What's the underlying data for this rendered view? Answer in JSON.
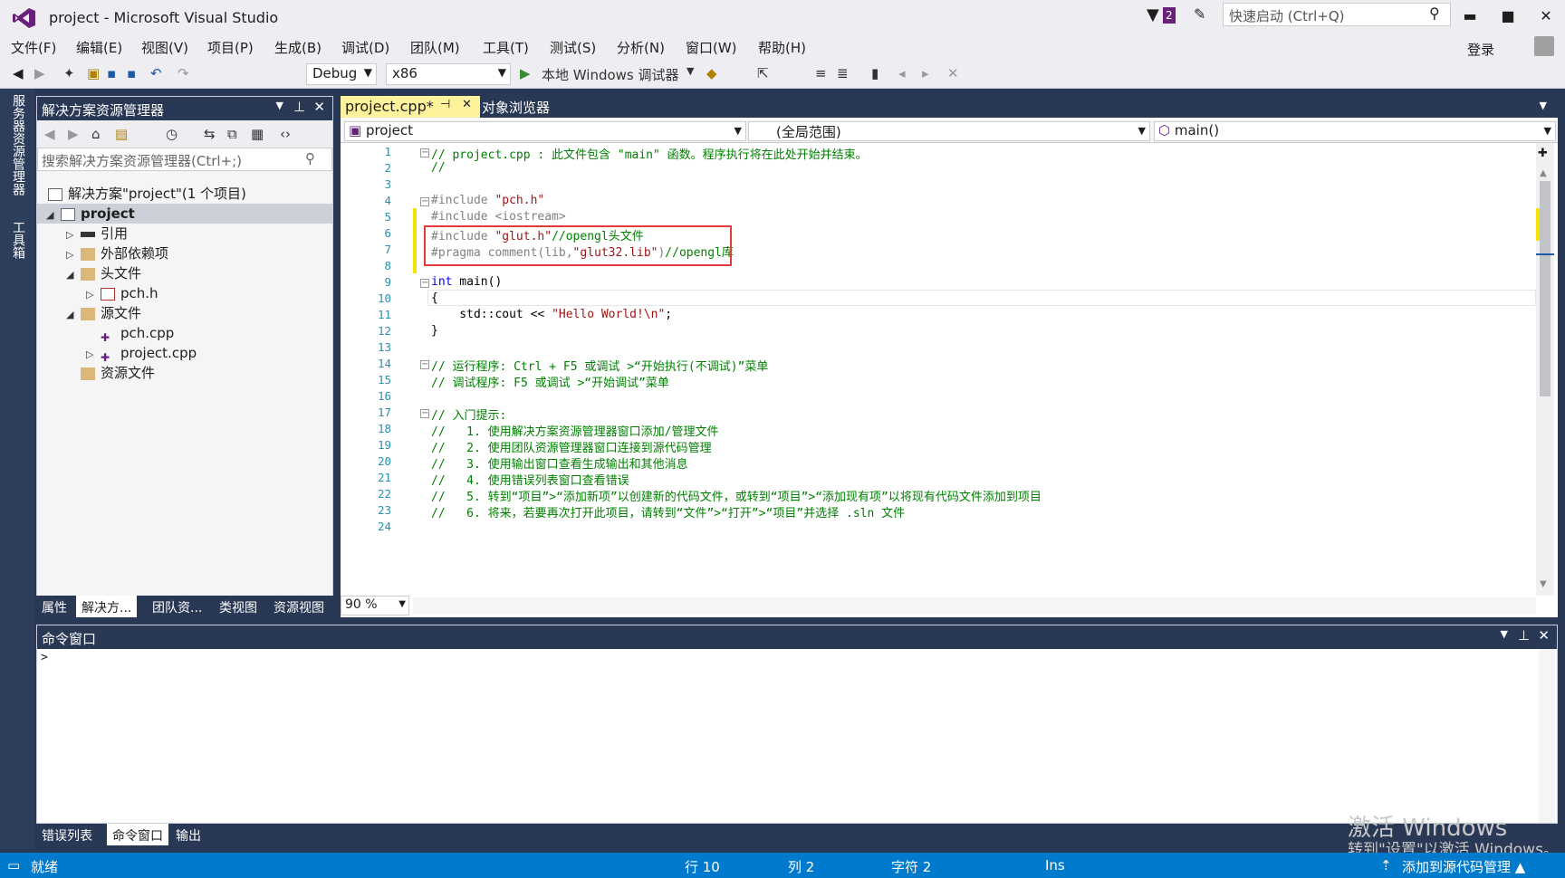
{
  "window": {
    "title": "project - Microsoft Visual Studio",
    "notification_count": "2",
    "quick_launch_placeholder": "快速启动 (Ctrl+Q)"
  },
  "menu": [
    "文件(F)",
    "编辑(E)",
    "视图(V)",
    "项目(P)",
    "生成(B)",
    "调试(D)",
    "团队(M)",
    "工具(T)",
    "测试(S)",
    "分析(N)",
    "窗口(W)",
    "帮助(H)"
  ],
  "signin": "登录",
  "toolbar": {
    "config": "Debug",
    "platform": "x86",
    "start_label": "本地 Windows 调试器"
  },
  "left_vtabs": [
    "服务器资源管理器",
    "工具箱"
  ],
  "solution_explorer": {
    "title": "解决方案资源管理器",
    "search_placeholder": "搜索解决方案资源管理器(Ctrl+;)",
    "items": [
      "解决方案\"project\"(1 个项目)",
      "project",
      "引用",
      "外部依赖项",
      "头文件",
      "pch.h",
      "源文件",
      "pch.cpp",
      "project.cpp",
      "资源文件"
    ],
    "bottom_tabs": [
      "属性",
      "解决方...",
      "团队资...",
      "类视图",
      "资源视图"
    ]
  },
  "editor": {
    "tabs": [
      "project.cpp*",
      "对象浏览器"
    ],
    "nav": {
      "project": "project",
      "scope": "(全局范围)",
      "member": "main()"
    },
    "zoom": "90 %"
  },
  "code_lines": [
    {
      "n": "1",
      "t": "// project.cpp : 此文件包含 \"main\" 函数。程序执行将在此处开始并结束。"
    },
    {
      "n": "2",
      "t": "//"
    },
    {
      "n": "3",
      "t": ""
    },
    {
      "n": "4",
      "t": "#include \"pch.h\""
    },
    {
      "n": "5",
      "t": "#include <iostream>"
    },
    {
      "n": "6",
      "t": "#include \"glut.h\"//opengl头文件"
    },
    {
      "n": "7",
      "t": "#pragma comment(lib,\"glut32.lib\")//opengl库"
    },
    {
      "n": "8",
      "t": ""
    },
    {
      "n": "9",
      "t": "int main()"
    },
    {
      "n": "10",
      "t": "{"
    },
    {
      "n": "11",
      "t": "    std::cout << \"Hello World!\\n\";"
    },
    {
      "n": "12",
      "t": "}"
    },
    {
      "n": "13",
      "t": ""
    },
    {
      "n": "14",
      "t": "// 运行程序: Ctrl + F5 或调试 >“开始执行(不调试)”菜单"
    },
    {
      "n": "15",
      "t": "// 调试程序: F5 或调试 >“开始调试”菜单"
    },
    {
      "n": "16",
      "t": ""
    },
    {
      "n": "17",
      "t": "// 入门提示:"
    },
    {
      "n": "18",
      "t": "//   1. 使用解决方案资源管理器窗口添加/管理文件"
    },
    {
      "n": "19",
      "t": "//   2. 使用团队资源管理器窗口连接到源代码管理"
    },
    {
      "n": "20",
      "t": "//   3. 使用输出窗口查看生成输出和其他消息"
    },
    {
      "n": "21",
      "t": "//   4. 使用错误列表窗口查看错误"
    },
    {
      "n": "22",
      "t": "//   5. 转到“项目”>“添加新项”以创建新的代码文件，或转到“项目”>“添加现有项”以将现有代码文件添加到项目"
    },
    {
      "n": "23",
      "t": "//   6. 将来，若要再次打开此项目，请转到“文件”>“打开”>“项目”并选择 .sln 文件"
    },
    {
      "n": "24",
      "t": ""
    }
  ],
  "command_window": {
    "title": "命令窗口",
    "prompt": ">",
    "bottom_tabs": [
      "错误列表",
      "命令窗口",
      "输出"
    ]
  },
  "status": {
    "ready": "就绪",
    "line": "行 10",
    "col": "列 2",
    "char": "字符 2",
    "ins": "Ins",
    "source_control": "添加到源代码管理 ▲"
  },
  "watermark": {
    "line1": "激活 Windows",
    "line2": "转到\"设置\"以激活 Windows。"
  }
}
